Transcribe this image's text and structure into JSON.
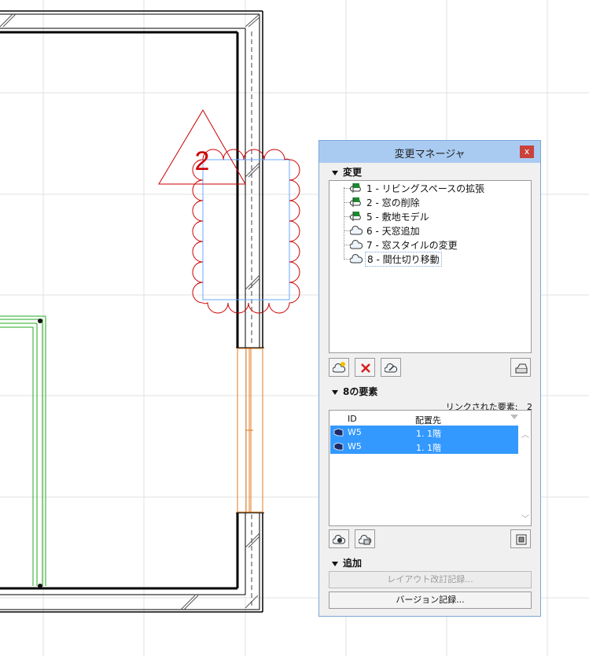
{
  "drawing": {
    "marker_number": "2",
    "colors": {
      "wall": "#000000",
      "cloud": "#cc0000",
      "marker": "#cc0000",
      "window": "#e07b20",
      "green": "#22aa22",
      "grid": "#e0e0e0",
      "selection": "#6aa9ff"
    }
  },
  "palette": {
    "title": "変更マネージャ",
    "close_label": "x",
    "changes_section": {
      "label": "変更",
      "items": [
        {
          "label": "1 - リビングスペースの拡張",
          "icon": "cloud-flag-icon"
        },
        {
          "label": "2 - 窓の削除",
          "icon": "cloud-flag-icon"
        },
        {
          "label": "5 - 敷地モデル",
          "icon": "cloud-flag-icon"
        },
        {
          "label": "6 - 天窓追加",
          "icon": "cloud-icon"
        },
        {
          "label": "7 - 窓スタイルの変更",
          "icon": "cloud-icon"
        },
        {
          "label": "8 - 間仕切り移動",
          "icon": "cloud-icon",
          "selected": true
        }
      ],
      "toolbar": [
        "new-change-icon",
        "delete-change-icon",
        "link-change-icon",
        "settings-icon"
      ]
    },
    "elements_section": {
      "label": "8の要素",
      "linked_label": "リンクされた要素:",
      "linked_count": "2",
      "columns": {
        "id": "ID",
        "location": "配置先"
      },
      "rows": [
        {
          "id": "W5",
          "location": "1. 1階"
        },
        {
          "id": "W5",
          "location": "1. 1階"
        }
      ],
      "toolbar": [
        "add-element-icon",
        "remove-element-icon",
        "show-element-icon"
      ]
    },
    "add_section": {
      "label": "追加",
      "layout_button": "レイアウト改訂記録...",
      "version_button": "バージョン記録..."
    }
  }
}
